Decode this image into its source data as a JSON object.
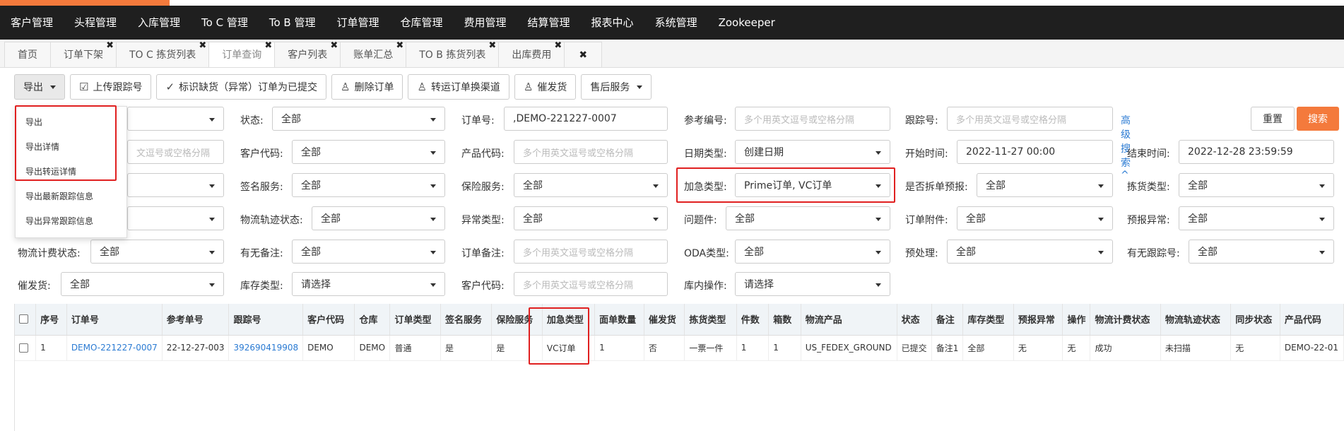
{
  "colors": {
    "accent": "#f47a3c",
    "nav_bg": "#1f1f1f",
    "link": "#2b7bd3",
    "highlight": "#e02020"
  },
  "topnav": [
    "客户管理",
    "头程管理",
    "入库管理",
    "To C 管理",
    "To B 管理",
    "订单管理",
    "仓库管理",
    "费用管理",
    "结算管理",
    "报表中心",
    "系统管理",
    "Zookeeper"
  ],
  "tabs": [
    {
      "label": "首页",
      "closable": false
    },
    {
      "label": "订单下架",
      "closable": true
    },
    {
      "label": "TO C 拣货列表",
      "closable": true
    },
    {
      "label": "订单查询",
      "closable": true,
      "active": true
    },
    {
      "label": "客户列表",
      "closable": true
    },
    {
      "label": "账单汇总",
      "closable": true
    },
    {
      "label": "TO B 拣货列表",
      "closable": true
    },
    {
      "label": "出库费用",
      "closable": true
    }
  ],
  "tab_close_all": "✖",
  "toolbar": {
    "export": "导出",
    "upload_tracking": "上传跟踪号",
    "mark_submitted": "标识缺货（异常）订单为已提交",
    "delete_order": "删除订单",
    "transfer_channel": "转运订单换渠道",
    "urge": "催发货",
    "after_sales": "售后服务"
  },
  "export_menu": [
    "导出",
    "导出详情",
    "导出转运详情",
    "导出最新跟踪信息",
    "导出异常跟踪信息"
  ],
  "filters": {
    "status_label": "状态:",
    "status_value": "全部",
    "order_no_label": "订单号:",
    "order_no_value": ",DEMO-221227-0007",
    "ref_no_label": "参考编号:",
    "ref_no_ph": "多个用英文逗号或空格分隔",
    "tracking_label": "跟踪号:",
    "tracking_ph": "多个用英文逗号或空格分隔",
    "advanced": "高级搜索^",
    "reset": "重置",
    "search": "搜索",
    "row2_col1_ph": "文逗号或空格分隔",
    "customer_code_label": "客户代码:",
    "customer_code_value": "全部",
    "product_code_label": "产品代码:",
    "product_code_ph": "多个用英文逗号或空格分隔",
    "date_type_label": "日期类型:",
    "date_type_value": "创建日期",
    "start_label": "开始时间:",
    "start_value": "2022-11-27 00:00",
    "end_label": "结束时间:",
    "end_value": "2022-12-28 23:59:59",
    "sign_label": "签名服务:",
    "sign_value": "全部",
    "insure_label": "保险服务:",
    "insure_value": "全部",
    "urgent_label": "加急类型:",
    "urgent_value": "Prime订单, VC订单",
    "split_label": "是否拆单预报:",
    "split_value": "全部",
    "pick_label": "拣货类型:",
    "pick_value": "全部",
    "track_status_label": "物流轨迹状态:",
    "track_status_value": "全部",
    "exception_label": "异常类型:",
    "exception_value": "全部",
    "problem_label": "问题件:",
    "problem_value": "全部",
    "attach_label": "订单附件:",
    "attach_value": "全部",
    "forecast_exc_label": "预报异常:",
    "forecast_exc_value": "全部",
    "fee_status_label": "物流计费状态:",
    "fee_status_value": "全部",
    "remark_label": "有无备注:",
    "remark_value": "全部",
    "order_remark_label": "订单备注:",
    "order_remark_ph": "多个用英文逗号或空格分隔",
    "oda_label": "ODA类型:",
    "oda_value": "全部",
    "preprocess_label": "预处理:",
    "preprocess_value": "全部",
    "has_tracking_label": "有无跟踪号:",
    "has_tracking_value": "全部",
    "urge_label": "催发货:",
    "urge_value": "全部",
    "stock_type_label": "库存类型:",
    "stock_type_value": "请选择",
    "customer_code2_label": "客户代码:",
    "customer_code2_ph": "多个用英文逗号或空格分隔",
    "wh_op_label": "库内操作:",
    "wh_op_value": "请选择"
  },
  "table": {
    "headers": [
      "序号",
      "订单号",
      "参考单号",
      "跟踪号",
      "客户代码",
      "仓库",
      "订单类型",
      "签名服务",
      "保险服务",
      "加急类型",
      "面单数量",
      "催发货",
      "拣货类型",
      "件数",
      "箱数",
      "物流产品",
      "状态",
      "备注",
      "库存类型",
      "预报异常",
      "操作",
      "物流计费状态",
      "物流轨迹状态",
      "同步状态",
      "产品代码"
    ],
    "rows": [
      [
        "1",
        "DEMO-221227-0007",
        "22-12-27-003",
        "392690419908",
        "DEMO",
        "DEMO",
        "普通",
        "是",
        "是",
        "VC订单",
        "1",
        "否",
        "一票一件",
        "1",
        "1",
        "US_FEDEX_GROUND",
        "已提交",
        "备注1",
        "全部",
        "无",
        "无",
        "成功",
        "未扫描",
        "无",
        "DEMO-22-01"
      ]
    ]
  }
}
